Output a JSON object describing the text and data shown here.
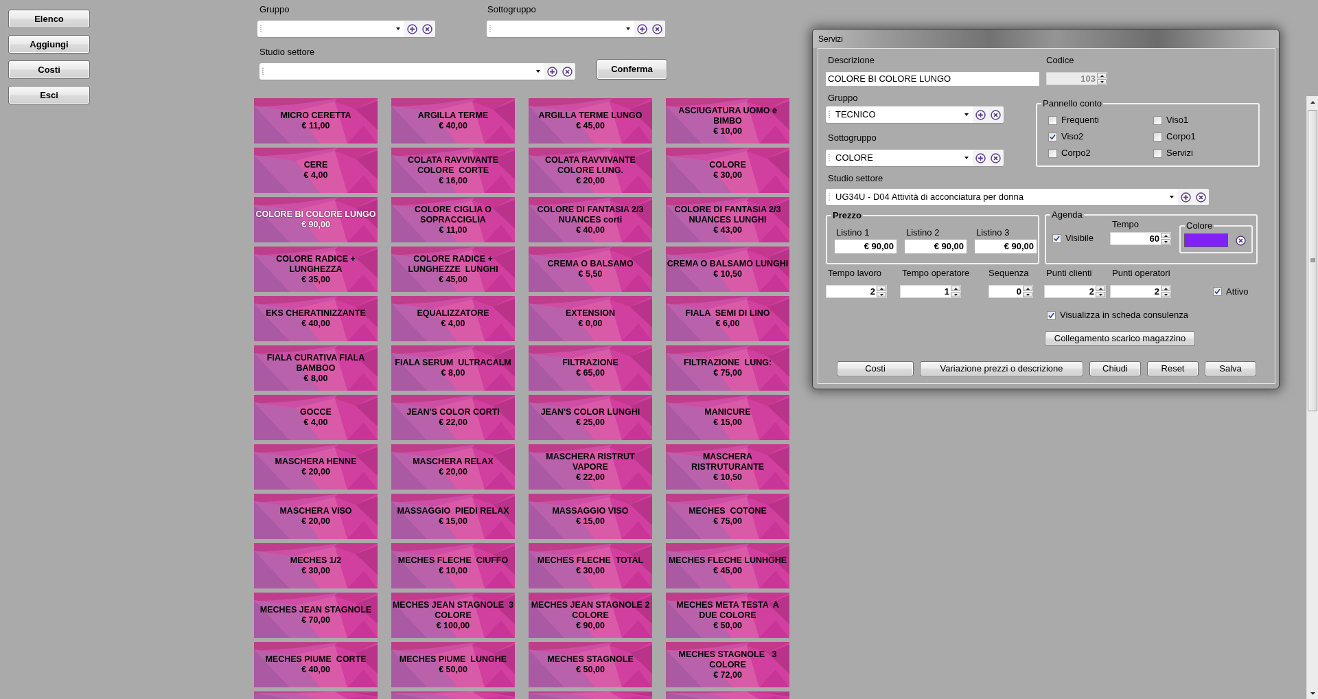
{
  "sidebar": {
    "buttons": [
      "Elenco",
      "Aggiungi",
      "Costi",
      "Esci"
    ]
  },
  "filters": {
    "gruppo": {
      "label": "Gruppo"
    },
    "sottogruppo": {
      "label": "Sottogruppo"
    },
    "studio_settore": {
      "label": "Studio settore"
    },
    "confirm_button": "Conferma"
  },
  "service_tiles": [
    {
      "name": "MICRO CERETTA",
      "price": "€ 11,00",
      "selected": false
    },
    {
      "name": "ARGILLA TERME",
      "price": "€ 40,00",
      "selected": false
    },
    {
      "name": "ARGILLA TERME LUNGO",
      "price": "€ 45,00",
      "selected": false
    },
    {
      "name": "ASCIUGATURA UOMO e\nBIMBO",
      "price": "€ 10,00",
      "selected": false
    },
    {
      "name": "CERE",
      "price": "€ 4,00",
      "selected": false
    },
    {
      "name": "COLATA RAVVIVANTE\nCOLORE  CORTE",
      "price": "€ 16,00",
      "selected": false
    },
    {
      "name": "COLATA RAVVIVANTE\nCOLORE LUNG.",
      "price": "€ 20,00",
      "selected": false
    },
    {
      "name": "COLORE",
      "price": "€ 30,00",
      "selected": false
    },
    {
      "name": "COLORE BI COLORE LUNGO",
      "price": "€ 90,00",
      "selected": true
    },
    {
      "name": "COLORE CIGLIA O\nSOPRACCIGLIA",
      "price": "€ 11,00",
      "selected": false
    },
    {
      "name": "COLORE DI FANTASIA 2/3\nNUANCES corti",
      "price": "€ 40,00",
      "selected": false
    },
    {
      "name": "COLORE DI FANTASIA 2/3\nNUANCES LUNGHI",
      "price": "€ 43,00",
      "selected": false
    },
    {
      "name": "COLORE RADICE +\nLUNGHEZZA",
      "price": "€ 35,00",
      "selected": false
    },
    {
      "name": "COLORE RADICE +\nLUNGHEZZE  LUNGHI",
      "price": "€ 45,00",
      "selected": false
    },
    {
      "name": "CREMA O BALSAMO",
      "price": "€ 5,50",
      "selected": false
    },
    {
      "name": "CREMA O BALSAMO LUNGHI",
      "price": "€ 10,50",
      "selected": false
    },
    {
      "name": "EKS CHERATINIZZANTE",
      "price": "€ 40,00",
      "selected": false
    },
    {
      "name": "EQUALIZZATORE",
      "price": "€ 4,00",
      "selected": false
    },
    {
      "name": "EXTENSION",
      "price": "€ 0,00",
      "selected": false
    },
    {
      "name": "FIALA  SEMI DI LINO",
      "price": "€ 6,00",
      "selected": false
    },
    {
      "name": "FIALA CURATIVA FIALA\nBAMBOO",
      "price": "€ 8,00",
      "selected": false
    },
    {
      "name": "FIALA SERUM  ULTRACALM",
      "price": "€ 8,00",
      "selected": false
    },
    {
      "name": "FILTRAZIONE",
      "price": "€ 65,00",
      "selected": false
    },
    {
      "name": "FILTRAZIONE  LUNG:",
      "price": "€ 75,00",
      "selected": false
    },
    {
      "name": "GOCCE",
      "price": "€ 4,00",
      "selected": false
    },
    {
      "name": "JEAN'S COLOR CORTI",
      "price": "€ 22,00",
      "selected": false
    },
    {
      "name": "JEAN'S COLOR LUNGHI",
      "price": "€ 25,00",
      "selected": false
    },
    {
      "name": "MANICURE",
      "price": "€ 15,00",
      "selected": false
    },
    {
      "name": "MASCHERA HENNE",
      "price": "€ 20,00",
      "selected": false
    },
    {
      "name": "MASCHERA RELAX",
      "price": "€ 20,00",
      "selected": false
    },
    {
      "name": "MASCHERA RISTRUT\nVAPORE",
      "price": "€ 22,00",
      "selected": false
    },
    {
      "name": "MASCHERA\nRISTRUTURANTE",
      "price": "€ 10,50",
      "selected": false
    },
    {
      "name": "MASCHERA VISO",
      "price": "€ 20,00",
      "selected": false
    },
    {
      "name": "MASSAGGIO  PIEDI RELAX",
      "price": "€ 15,00",
      "selected": false
    },
    {
      "name": "MASSAGGIO VISO",
      "price": "€ 15,00",
      "selected": false
    },
    {
      "name": "MECHES  COTONE",
      "price": "€ 75,00",
      "selected": false
    },
    {
      "name": "MECHES 1/2",
      "price": "€ 30,00",
      "selected": false
    },
    {
      "name": "MECHES FLECHE  CIUFFO",
      "price": "€ 10,00",
      "selected": false
    },
    {
      "name": "MECHES FLECHE  TOTAL",
      "price": "€ 30,00",
      "selected": false
    },
    {
      "name": "MECHES FLECHE LUNHGHE",
      "price": "€ 45,00",
      "selected": false
    },
    {
      "name": "MECHES JEAN STAGNOLE",
      "price": "€ 70,00",
      "selected": false
    },
    {
      "name": "MECHES JEAN STAGNOLE  3\nCOLORE",
      "price": "€ 100,00",
      "selected": false
    },
    {
      "name": "MECHES JEAN STAGNOLE 2\nCOLORE",
      "price": "€ 90,00",
      "selected": false
    },
    {
      "name": "MECHES META TESTA  A\nDUE COLORE",
      "price": "€ 50,00",
      "selected": false
    },
    {
      "name": "MECHES PIUME  CORTE",
      "price": "€ 40,00",
      "selected": false
    },
    {
      "name": "MECHES PIUME  LUNGHE",
      "price": "€ 50,00",
      "selected": false
    },
    {
      "name": "MECHES STAGNOLE",
      "price": "€ 50,00",
      "selected": false
    },
    {
      "name": "MECHES STAGNOLE   3\nCOLORE",
      "price": "€ 72,00",
      "selected": false
    }
  ],
  "more_rows_below": true,
  "dialog": {
    "title": "Servizi",
    "descrizione": {
      "label": "Descrizione",
      "value": "COLORE BI COLORE LUNGO"
    },
    "codice": {
      "label": "Codice",
      "value": "103",
      "disabled": true
    },
    "gruppo": {
      "label": "Gruppo",
      "value": "TECNICO"
    },
    "sottogruppo": {
      "label": "Sottogruppo",
      "value": "COLORE"
    },
    "pannello_conto": {
      "title": "Pannello conto",
      "options": [
        {
          "label": "Frequenti",
          "checked": false
        },
        {
          "label": "Viso1",
          "checked": false
        },
        {
          "label": "Viso2",
          "checked": true
        },
        {
          "label": "Corpo1",
          "checked": false
        },
        {
          "label": "Corpo2",
          "checked": false
        },
        {
          "label": "Servizi",
          "checked": false
        }
      ]
    },
    "studio_settore": {
      "label": "Studio settore",
      "value": "UG34U - D04 Attività di acconciatura per donna"
    },
    "prezzo": {
      "title": "Prezzo",
      "listini": [
        {
          "label": "Listino 1",
          "value": "€ 90,00"
        },
        {
          "label": "Listino 2",
          "value": "€ 90,00"
        },
        {
          "label": "Listino 3",
          "value": "€ 90,00"
        }
      ]
    },
    "agenda": {
      "title": "Agenda",
      "visibile": {
        "label": "Visibile",
        "checked": true
      },
      "tempo": {
        "label": "Tempo",
        "value": "60"
      },
      "colore": {
        "title": "Colore",
        "color": "#8022f5"
      }
    },
    "numeric_fields": [
      {
        "label": "Tempo lavoro",
        "value": "2"
      },
      {
        "label": "Tempo operatore",
        "value": "1"
      },
      {
        "label": "Sequenza",
        "value": "0"
      },
      {
        "label": "Punti clienti",
        "value": "2"
      },
      {
        "label": "Punti operatori",
        "value": "2"
      }
    ],
    "attivo": {
      "label": "Attivo",
      "checked": true
    },
    "visualizza_consulenza": {
      "label": "Visualizza in scheda consulenza",
      "checked": true
    },
    "link_button": "Collegamento scarico magazzino",
    "buttons": [
      "Costi",
      "Variazione prezzi o descrizione",
      "Chiudi",
      "Reset",
      "Salva"
    ]
  }
}
